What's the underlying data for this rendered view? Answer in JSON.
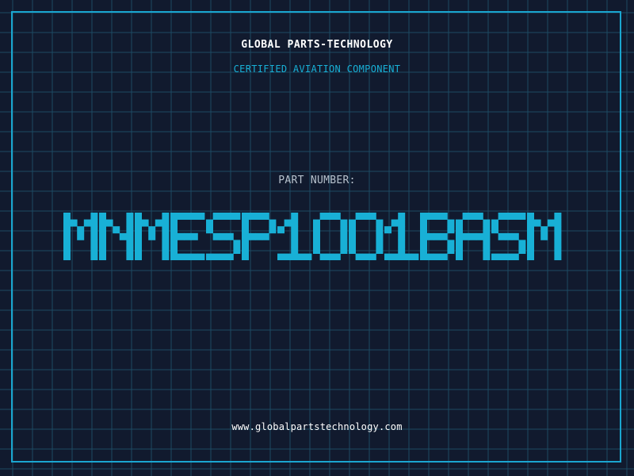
{
  "header": {
    "company": "GLOBAL PARTS-TECHNOLOGY",
    "subtitle": "CERTIFIED AVIATION COMPONENT"
  },
  "part": {
    "label": "PART NUMBER:",
    "number": "MNMESP1001BASM"
  },
  "footer": {
    "website": "www.globalpartstechnology.com"
  },
  "colors": {
    "background": "#111a2e",
    "grid": "#1d4a63",
    "frame": "#1aa6d0",
    "accent": "#18b0d6",
    "white": "#ffffff",
    "label_gray": "#b7c2cd"
  }
}
